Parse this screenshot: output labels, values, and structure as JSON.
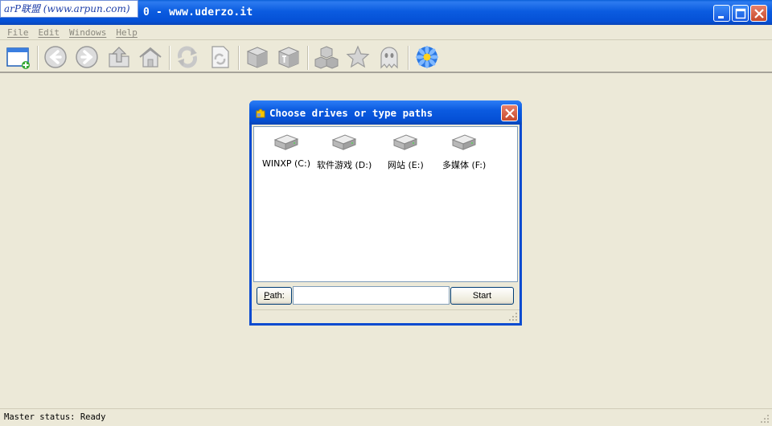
{
  "window": {
    "title": "0 - www.uderzo.it",
    "watermark": "arP联盟 (www.arpun.com)"
  },
  "menu": [
    {
      "label": "File"
    },
    {
      "label": "Edit"
    },
    {
      "label": "Windows"
    },
    {
      "label": "Help"
    }
  ],
  "toolbar": {
    "icons": [
      "new-window-icon",
      "back-icon",
      "forward-icon",
      "up-folder-icon",
      "home-icon",
      "refresh-icon",
      "reload-page-icon",
      "cube-icon",
      "cube-text-icon",
      "cubes-icon",
      "star-icon",
      "ghost-icon",
      "flower-icon"
    ]
  },
  "dialog": {
    "title": "Choose drives or type paths",
    "drives": [
      {
        "label": "WINXP (C:)"
      },
      {
        "label": "软件游戏 (D:)"
      },
      {
        "label": "网站 (E:)"
      },
      {
        "label": "多媒体 (F:)"
      }
    ],
    "path_button_letter": "P",
    "path_button_rest": "ath:",
    "path_value": "",
    "start_label": "Start"
  },
  "status": {
    "text": "Master status: Ready"
  },
  "colors": {
    "titlebar": "#0550d6",
    "face": "#ece9d8",
    "close": "#c74a2c"
  }
}
